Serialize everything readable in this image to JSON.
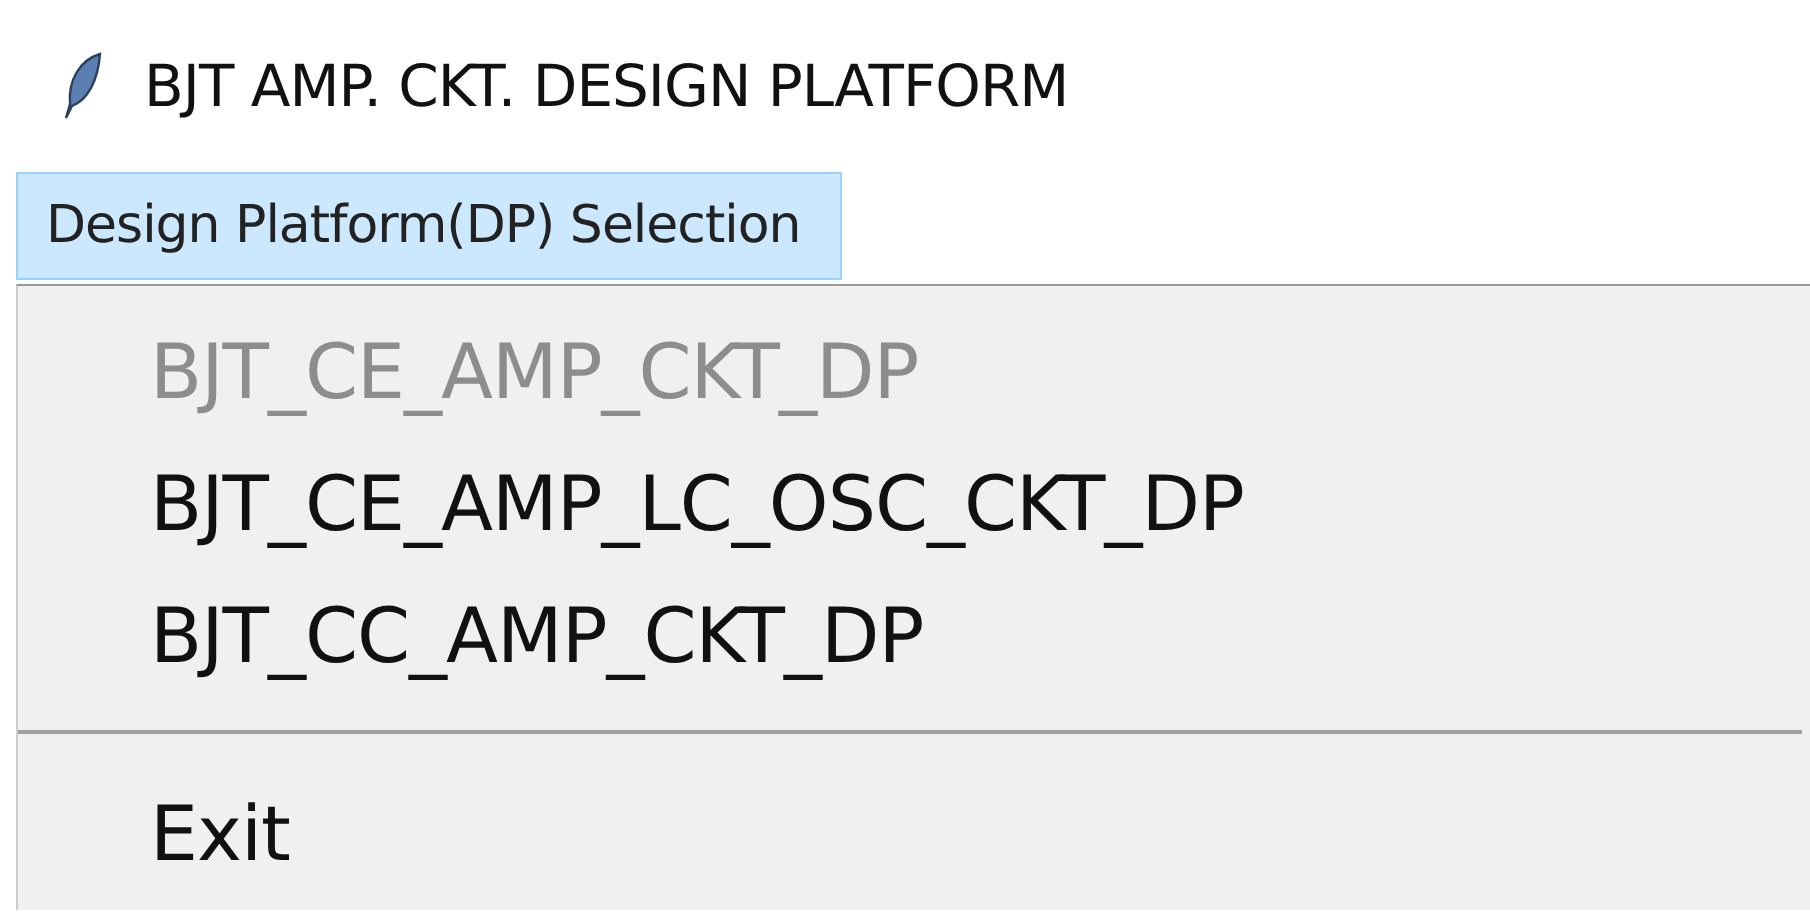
{
  "window": {
    "title": "BJT AMP. CKT. DESIGN PLATFORM"
  },
  "menubar": [
    {
      "label": "Design Platform(DP) Selection",
      "selected": true
    }
  ],
  "menu": [
    {
      "kind": "item",
      "label": "BJT_CE_AMP_CKT_DP",
      "disabled": true
    },
    {
      "kind": "item",
      "label": "BJT_CE_AMP_LC_OSC_CKT_DP",
      "disabled": false
    },
    {
      "kind": "item",
      "label": "BJT_CC_AMP_CKT_DP",
      "disabled": false
    },
    {
      "kind": "separator"
    },
    {
      "kind": "item",
      "label": "Exit",
      "disabled": false
    }
  ]
}
